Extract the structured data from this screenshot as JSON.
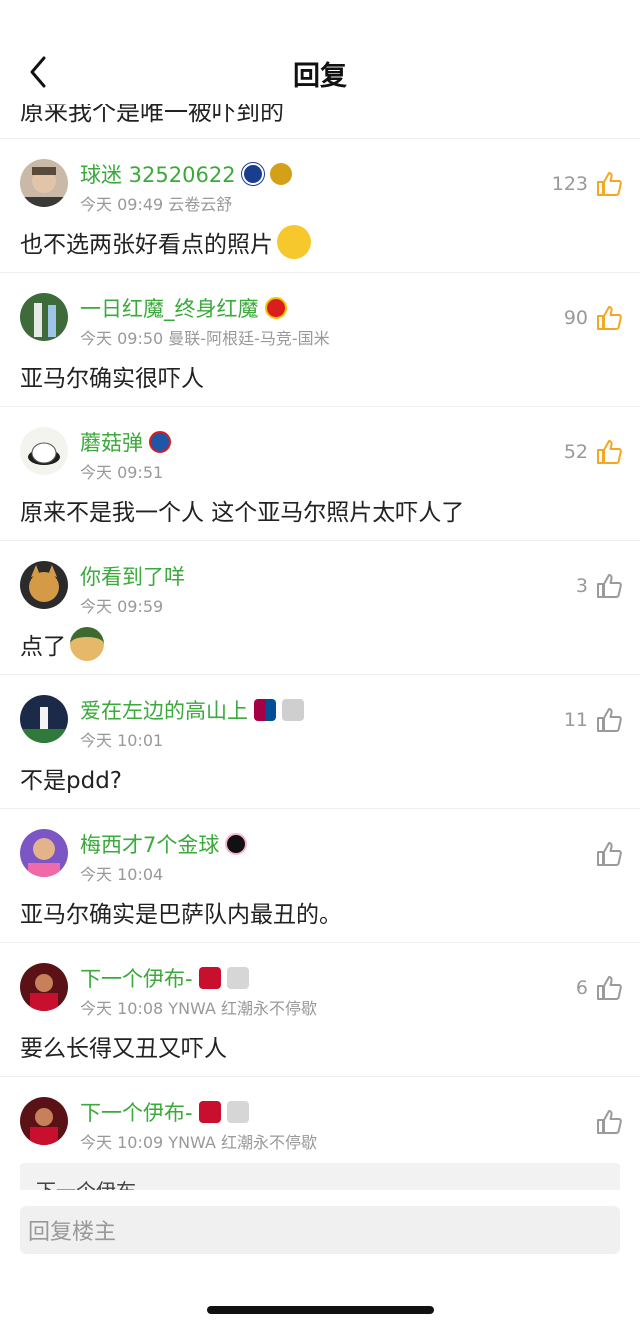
{
  "header": {
    "title": "回复"
  },
  "cut_text": "原来我个是唯一被吓到的",
  "comments": [
    {
      "username": "球迷 32520622",
      "time": "今天 09:49",
      "extra": "云卷云舒",
      "text": "也不选两张好看点的照片",
      "likes": "123",
      "liked": true
    },
    {
      "username": "一日红魔_终身红魔",
      "time": "今天 09:50",
      "extra": "曼联-阿根廷-马竞-国米",
      "text": "亚马尔确实很吓人",
      "likes": "90",
      "liked": true
    },
    {
      "username": "蘑菇弹",
      "time": "今天 09:51",
      "extra": "",
      "text": "原来不是我一个人 这个亚马尔照片太吓人了",
      "likes": "52",
      "liked": true
    },
    {
      "username": "你看到了咩",
      "time": "今天 09:59",
      "extra": "",
      "text": "点了",
      "likes": "3",
      "liked": false
    },
    {
      "username": "爱在左边的高山上",
      "time": "今天 10:01",
      "extra": "",
      "text": "不是pdd?",
      "likes": "11",
      "liked": false
    },
    {
      "username": "梅西才7个金球",
      "time": "今天 10:04",
      "extra": "",
      "text": "亚马尔确实是巴萨队内最丑的。",
      "likes": "",
      "liked": false
    },
    {
      "username": "下一个伊布-",
      "time": "今天 10:08",
      "extra": "YNWA 红潮永不停歇",
      "text": "要么长得又丑又吓人",
      "likes": "6",
      "liked": false
    },
    {
      "username": "下一个伊布-",
      "time": "今天 10:09",
      "extra": "YNWA 红潮永不停歇",
      "text": "",
      "likes": "",
      "liked": false
    }
  ],
  "partial_reply": "下一个伊布-",
  "reply": {
    "placeholder": "回复楼主"
  },
  "colors": {
    "username": "#3aaa3a",
    "like_active": "#f5a623",
    "like_inactive": "#9a9a9a"
  }
}
